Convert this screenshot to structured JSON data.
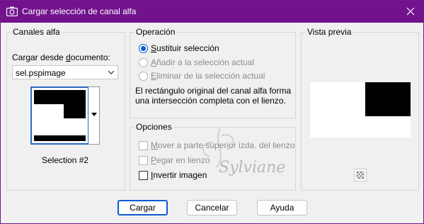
{
  "window": {
    "title": "Cargar selección de canal alfa",
    "accent": "#72138d"
  },
  "alpha_channels": {
    "group_title": "Canales alfa",
    "load_from_label_pre": "Cargar desde ",
    "load_from_label_u": "d",
    "load_from_label_post": "ocumento:",
    "document_value": "sel.pspimage",
    "selection_name": "Selection #2"
  },
  "operation": {
    "group_title": "Operación",
    "options": [
      {
        "u": "S",
        "rest": "ustituir selección",
        "selected": true,
        "enabled": true
      },
      {
        "u": "A",
        "rest": "ñadir a la selección actual",
        "selected": false,
        "enabled": false
      },
      {
        "u": "E",
        "rest": "liminar de la selección actual",
        "selected": false,
        "enabled": false
      }
    ],
    "description": "El rectángulo original del canal alfa forma una intersección completa con el lienzo."
  },
  "options": {
    "group_title": "Opciones",
    "move_pre": "",
    "move_u": "M",
    "move_post": "over a parte superior izda. del lienzo",
    "paste_u": "P",
    "paste_post": "egar en lienzo",
    "invert_u": "I",
    "invert_post": "nvertir imagen"
  },
  "preview": {
    "group_title": "Vista previa",
    "checker_icon": "transparency-checker-icon"
  },
  "buttons": {
    "load": "Cargar",
    "cancel": "Cancelar",
    "help": "Ayuda"
  },
  "watermark": {
    "text": "Sylviane"
  }
}
